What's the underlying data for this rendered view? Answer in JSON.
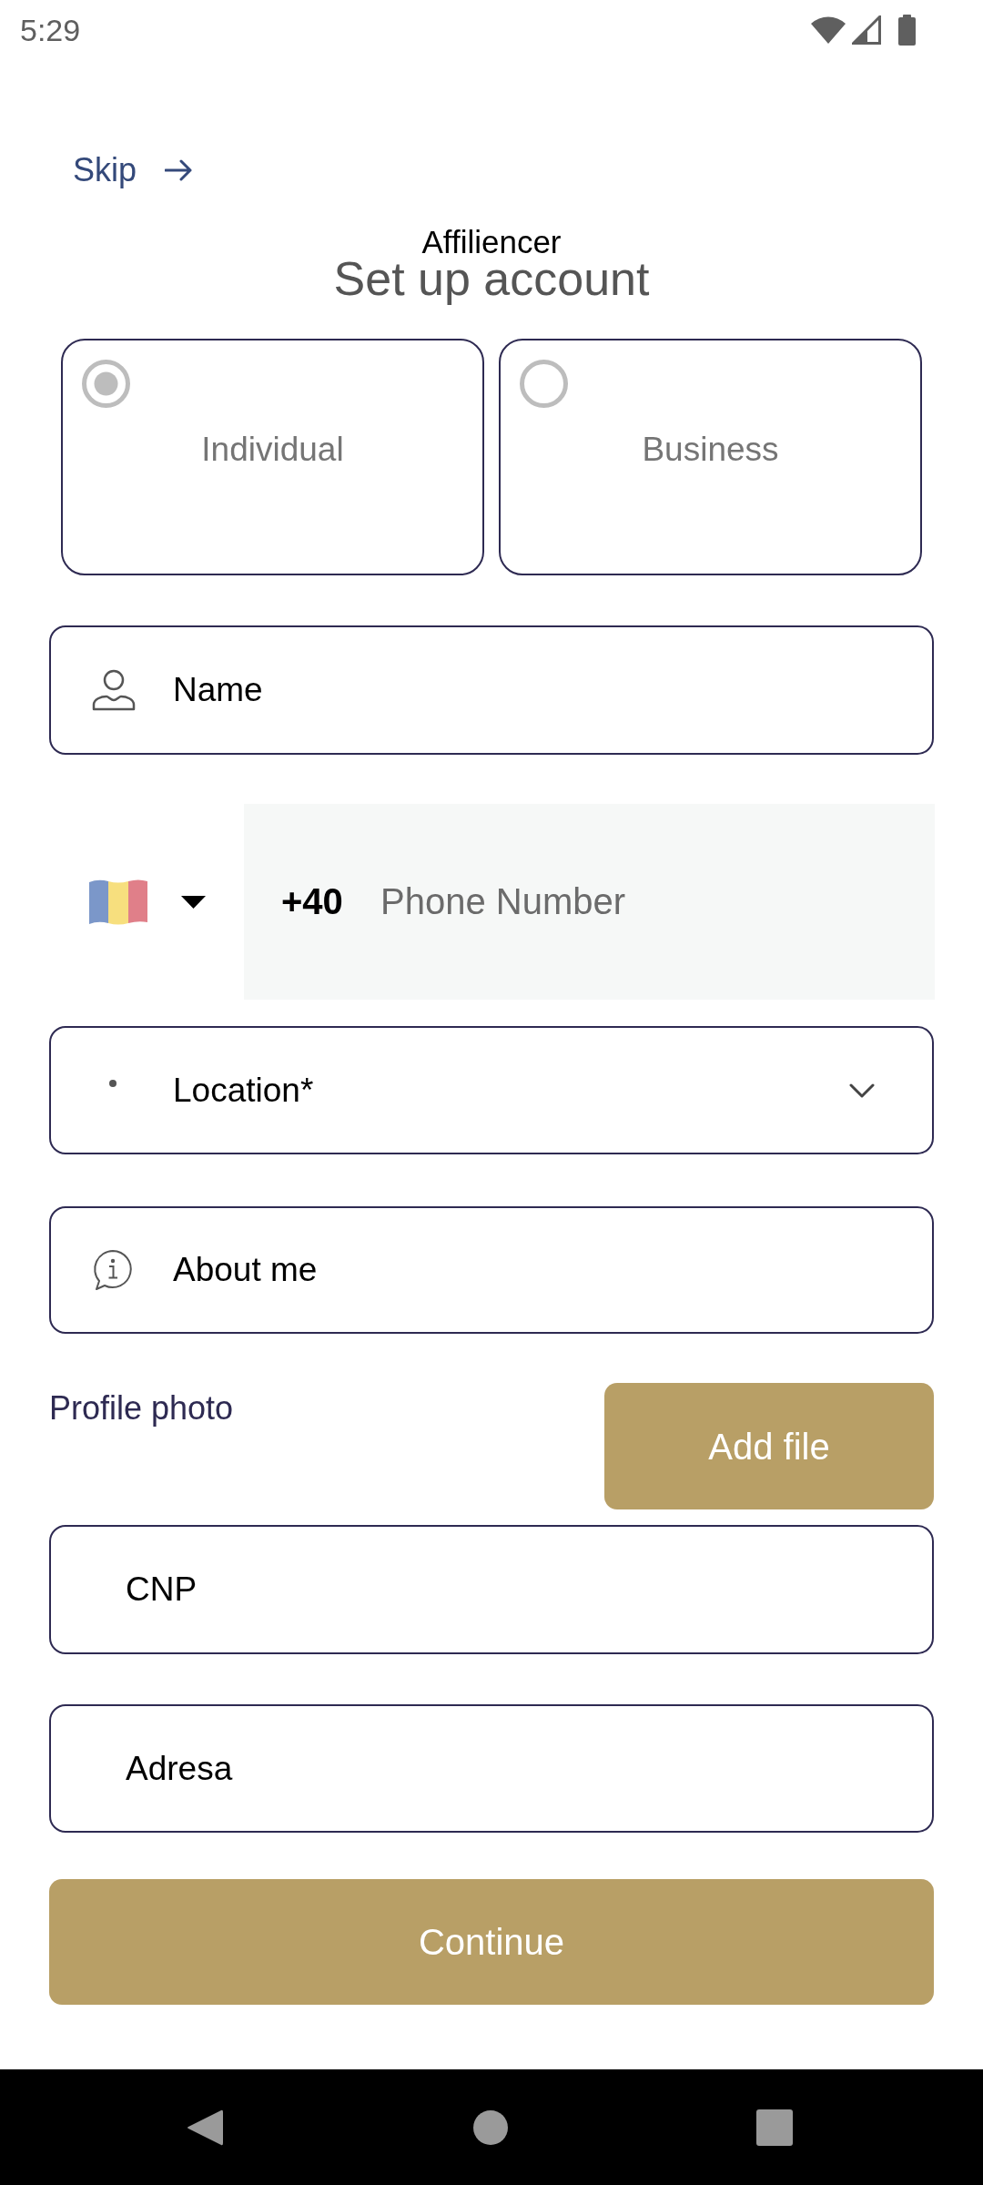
{
  "status_bar": {
    "time": "5:29"
  },
  "skip": {
    "label": "Skip"
  },
  "header": {
    "app_name": "Affiliencer",
    "title": "Set up account"
  },
  "account_types": [
    {
      "label": "Individual",
      "selected": true
    },
    {
      "label": "Business",
      "selected": false
    }
  ],
  "name_field": {
    "placeholder": "Name"
  },
  "phone_field": {
    "country_code": "+40",
    "placeholder": "Phone Number"
  },
  "location_select": {
    "placeholder": "Location*"
  },
  "about_field": {
    "placeholder": "About me"
  },
  "profile_photo": {
    "label": "Profile photo",
    "button": "Add file"
  },
  "cnp_field": {
    "placeholder": "CNP"
  },
  "address_field": {
    "placeholder": "Adresa"
  },
  "continue_button": {
    "label": "Continue"
  }
}
